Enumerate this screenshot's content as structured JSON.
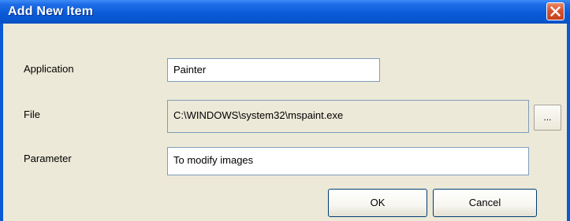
{
  "window": {
    "title": "Add New Item"
  },
  "form": {
    "application_label": "Application",
    "application_value": "Painter",
    "file_label": "File",
    "file_value": "C:\\WINDOWS\\system32\\mspaint.exe",
    "browse_label": "...",
    "parameter_label": "Parameter",
    "parameter_value": "To modify images"
  },
  "buttons": {
    "ok_label": "OK",
    "cancel_label": "Cancel"
  },
  "icons": {
    "close": "close-icon"
  },
  "colors": {
    "titlebar": "#0a5bd9",
    "close_button": "#d8532b",
    "client_background": "#ece9d8",
    "field_border": "#7f9db9"
  }
}
